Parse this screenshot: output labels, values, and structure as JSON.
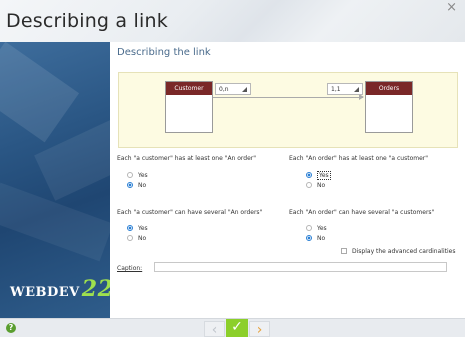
{
  "window": {
    "title": "Describing a link",
    "close_glyph": "×"
  },
  "brand": {
    "logo_text": "WEBDEV",
    "logo_version": "22"
  },
  "main": {
    "heading": "Describing the link"
  },
  "diagram": {
    "left_entity": "Customer",
    "right_entity": "Orders",
    "left_cardinality": "0,n",
    "right_cardinality": "1,1"
  },
  "questions": {
    "q1": {
      "label": "Each \"a customer\" has at least one \"An order\"",
      "yes": "Yes",
      "no": "No",
      "selected": "No"
    },
    "q2": {
      "label": "Each \"An order\" has at least one \"a customer\"",
      "yes": "Yes",
      "no": "No",
      "selected": "Yes"
    },
    "q3": {
      "label": "Each \"a customer\" can have several \"An orders\"",
      "yes": "Yes",
      "no": "No",
      "selected": "Yes"
    },
    "q4": {
      "label": "Each \"An order\" can have several \"a customers\"",
      "yes": "Yes",
      "no": "No",
      "selected": "No"
    }
  },
  "options": {
    "advanced_cardinalities": "Display the advanced cardinalities",
    "advanced_checked": false
  },
  "caption": {
    "label": "Caption:",
    "value": ""
  },
  "footer": {
    "help_glyph": "?",
    "prev_glyph": "‹",
    "finish_glyph": "✓",
    "next_glyph": "›"
  },
  "colors": {
    "entity_header": "#7a2828",
    "diagram_bg": "#fdfbe2",
    "radio_selected": "#2a7fd4",
    "finish_button": "#8ccf2a",
    "heading_text": "#4a6b8c",
    "side_panel": "#2a5684"
  }
}
